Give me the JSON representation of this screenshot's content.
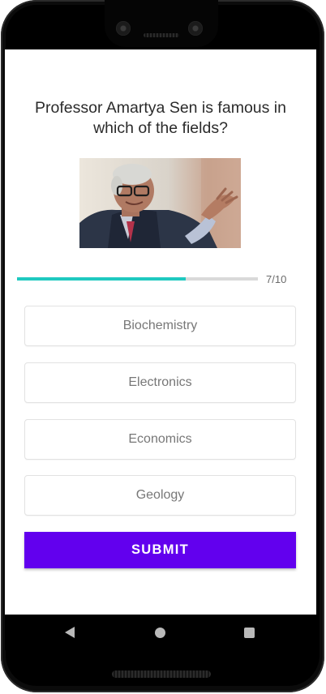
{
  "quiz": {
    "question": "Professor Amartya Sen is famous in which of the fields?",
    "progress": {
      "current": 7,
      "total": 10,
      "label": "7/10",
      "fraction": 0.7
    },
    "options": [
      {
        "label": "Biochemistry"
      },
      {
        "label": "Electronics"
      },
      {
        "label": "Economics"
      },
      {
        "label": "Geology"
      }
    ],
    "submit_label": "SUBMIT"
  },
  "colors": {
    "accent": "#6200ee",
    "progress_fill": "#1fc9c0",
    "progress_track": "#d9d9d9",
    "option_text": "#777777",
    "question_text": "#2b2b2b"
  },
  "icons": {
    "nav_back": "back-triangle-icon",
    "nav_home": "home-circle-icon",
    "nav_recents": "recents-square-icon"
  }
}
